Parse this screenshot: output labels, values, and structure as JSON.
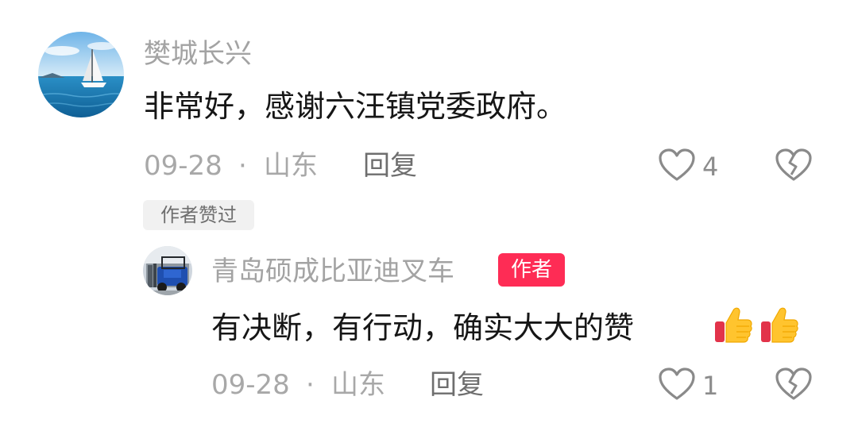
{
  "comments": [
    {
      "username": "樊城长兴",
      "text": "非常好，感谢六汪镇党委政府。",
      "date": "09-28",
      "separator": "·",
      "location": "山东",
      "reply_label": "回复",
      "like_count": "4",
      "liked_by_author_tag": "作者赞过",
      "avatar_icon": "sailboat-on-sea-avatar"
    },
    {
      "username": "青岛硕成比亚迪叉车",
      "author_badge": "作者",
      "text": "有决断，有行动，确实大大的赞",
      "date": "09-28",
      "separator": "·",
      "location": "山东",
      "reply_label": "回复",
      "like_count": "1",
      "avatar_icon": "blue-forklift-avatar"
    }
  ],
  "icons": {
    "like": "heart-outline-icon",
    "dislike": "broken-heart-icon",
    "emoji": "thumbs-up-emoji"
  },
  "colors": {
    "author_badge": "#fe2c55",
    "username": "#a3a3a3",
    "body_text": "#161616",
    "meta": "#a8a8a8"
  }
}
